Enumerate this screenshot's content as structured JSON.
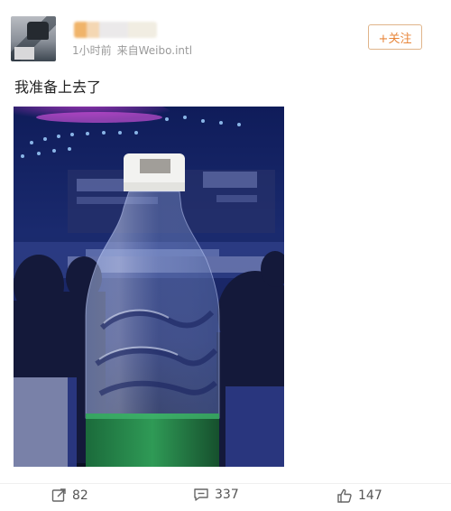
{
  "post": {
    "meta": {
      "time": "1小时前",
      "source": "来自Weibo.intl"
    },
    "follow_label": "+关注",
    "text": "我准备上去了"
  },
  "actions": {
    "repost_count": "82",
    "comment_count": "337",
    "like_count": "147"
  },
  "icons": {
    "repost": "share-icon",
    "comment": "comment-icon",
    "like": "thumbs-up-icon"
  }
}
